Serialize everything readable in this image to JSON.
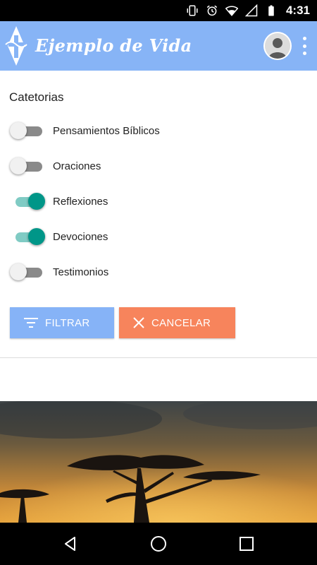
{
  "status_bar": {
    "time": "4:31",
    "icons": [
      "vibrate-icon",
      "alarm-icon",
      "wifi-icon",
      "signal-icon",
      "battery-icon"
    ]
  },
  "app_bar": {
    "title": "Ejemplo de Vida",
    "color": "#87b4f6",
    "icons": [
      "logo-cross-icon",
      "avatar-icon",
      "overflow-menu-icon"
    ]
  },
  "filter": {
    "section_title": "Catetorias",
    "categories": [
      {
        "label": "Pensamientos Bíblicos",
        "enabled": false
      },
      {
        "label": "Oraciones",
        "enabled": false
      },
      {
        "label": "Reflexiones",
        "enabled": true
      },
      {
        "label": "Devociones",
        "enabled": true
      },
      {
        "label": "Testimonios",
        "enabled": false
      }
    ],
    "filter_button": {
      "label": "FILTRAR",
      "icon": "filter-icon",
      "color": "#86b3f7"
    },
    "cancel_button": {
      "label": "CANCELAR",
      "icon": "close-icon",
      "color": "#f7845c"
    }
  },
  "toggle_on_color": "#009688",
  "nav_bar": {
    "icons": [
      "back-icon",
      "home-icon",
      "recents-icon"
    ]
  }
}
